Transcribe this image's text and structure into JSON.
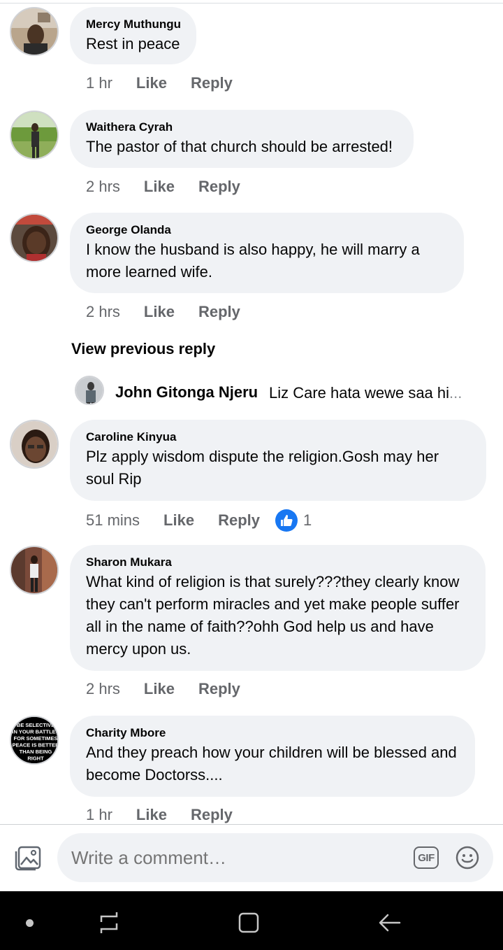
{
  "comments": [
    {
      "author": "Mercy Muthungu",
      "text": "Rest in peace",
      "time": "1 hr",
      "like": "Like",
      "reply": "Reply"
    },
    {
      "author": "Waithera Cyrah",
      "text": "The pastor of that church should be arrested!",
      "time": "2 hrs",
      "like": "Like",
      "reply": "Reply"
    },
    {
      "author": "George Olanda",
      "text": "I know the husband is also happy, he will marry a more learned wife.",
      "time": "2 hrs",
      "like": "Like",
      "reply": "Reply"
    },
    {
      "author": "Caroline Kinyua",
      "text": "Plz apply wisdom dispute the religion.Gosh may her soul Rip",
      "time": "51 mins",
      "like": "Like",
      "reply": "Reply",
      "reaction_count": "1"
    },
    {
      "author": "Sharon Mukara",
      "text": "What kind of religion is that surely???they clearly know they can't perform miracles and yet make people suffer all in the name of faith??ohh God help us and have mercy upon us.",
      "time": "2 hrs",
      "like": "Like",
      "reply": "Reply"
    },
    {
      "author": "Charity Mbore",
      "text": "And they preach how your children will be blessed and become Doctorss....",
      "time": "1 hr",
      "like": "Like",
      "reply": "Reply"
    }
  ],
  "thread": {
    "view_previous": "View previous reply",
    "reply_author": "John Gitonga Njeru",
    "reply_text": "Liz Care hata wewe saa hi",
    "reply_ellipsis": "..."
  },
  "avatar_texts": {
    "charity": [
      "BE SELECTIVE",
      "IN YOUR BATTLES",
      "FOR SOMETIMES",
      "PEACE IS BETTER",
      "THAN BEING",
      "RIGHT"
    ]
  },
  "composer": {
    "placeholder": "Write a comment…",
    "gif_label": "GIF",
    "photo_icon": "photo-icon",
    "emoji_icon": "emoji-icon"
  },
  "colors": {
    "bubble": "#f0f2f5",
    "meta": "#65676b",
    "like_blue": "#1877f2"
  }
}
